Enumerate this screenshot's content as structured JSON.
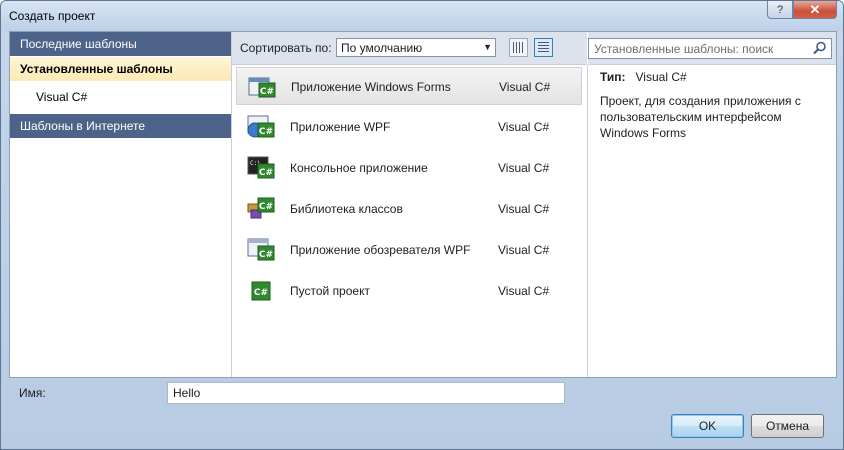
{
  "window": {
    "title": "Создать проект"
  },
  "sidebar": {
    "recent": "Последние шаблоны",
    "installed": "Установленные шаблоны",
    "installed_child": "Visual C#",
    "online": "Шаблоны в Интернете"
  },
  "toolbar": {
    "sort_label": "Сортировать по:",
    "sort_value": "По умолчанию"
  },
  "search": {
    "placeholder": "Установленные шаблоны: поиск"
  },
  "templates": [
    {
      "name": "Приложение Windows Forms",
      "type": "Visual C#",
      "icon": "windows-forms-icon",
      "selected": true
    },
    {
      "name": "Приложение WPF",
      "type": "Visual C#",
      "icon": "wpf-icon",
      "selected": false
    },
    {
      "name": "Консольное приложение",
      "type": "Visual C#",
      "icon": "console-app-icon",
      "selected": false
    },
    {
      "name": "Библиотека классов",
      "type": "Visual C#",
      "icon": "class-library-icon",
      "selected": false
    },
    {
      "name": "Приложение обозревателя WPF",
      "type": "Visual C#",
      "icon": "wpf-browser-icon",
      "selected": false
    },
    {
      "name": "Пустой проект",
      "type": "Visual C#",
      "icon": "empty-project-icon",
      "selected": false
    }
  ],
  "details": {
    "type_label": "Тип:",
    "type_value": "Visual C#",
    "description": "Проект, для создания приложения с пользовательским интерфейсом Windows Forms"
  },
  "form": {
    "name_label": "Имя:",
    "name_value": "Hello"
  },
  "buttons": {
    "ok": "OK",
    "cancel": "Отмена"
  },
  "colors": {
    "sidebar_header": "#4d6389",
    "selection": "#fde9b5",
    "accent": "#3c7fb1"
  }
}
